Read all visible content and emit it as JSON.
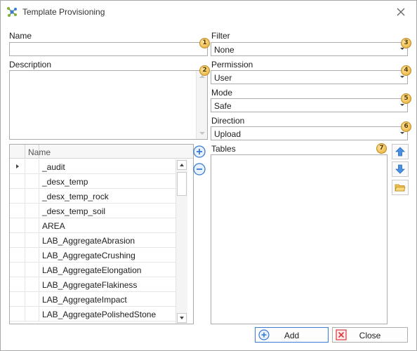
{
  "window": {
    "title": "Template Provisioning",
    "app_icon": "provisioning-app-icon",
    "close_icon": "close-icon"
  },
  "form": {
    "name": {
      "label": "Name",
      "value": "",
      "badge": "1"
    },
    "description": {
      "label": "Description",
      "value": "",
      "badge": "2"
    },
    "filter": {
      "label": "Filter",
      "value": "None",
      "badge": "3"
    },
    "permission": {
      "label": "Permission",
      "value": "User",
      "badge": "4"
    },
    "mode": {
      "label": "Mode",
      "value": "Safe",
      "badge": "5"
    },
    "direction": {
      "label": "Direction",
      "value": "Upload",
      "badge": "6"
    },
    "tables": {
      "label": "Tables",
      "badge": "7"
    }
  },
  "grid": {
    "column_header": "Name",
    "rows": [
      "_audit",
      "_desx_temp",
      "_desx_temp_rock",
      "_desx_temp_soil",
      "AREA",
      "LAB_AggregateAbrasion",
      "LAB_AggregateCrushing",
      "LAB_AggregateElongation",
      "LAB_AggregateFlakiness",
      "LAB_AggregateImpact",
      "LAB_AggregatePolishedStone"
    ]
  },
  "side_buttons": {
    "add_icon": "plus-circle-icon",
    "remove_icon": "minus-circle-icon"
  },
  "table_tools": {
    "up_icon": "arrow-up-icon",
    "down_icon": "arrow-down-icon",
    "open_icon": "folder-open-icon"
  },
  "actions": {
    "add_label": "Add",
    "close_label": "Close"
  },
  "colors": {
    "accent_blue": "#3a7bd5",
    "close_red": "#d9363e",
    "badge_gold": "#f0c25a"
  }
}
